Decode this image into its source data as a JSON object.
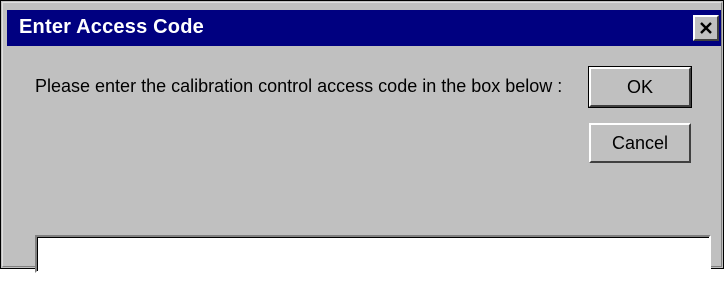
{
  "window": {
    "title": "Enter Access Code",
    "close_icon": "close-icon"
  },
  "content": {
    "prompt": "Please enter the calibration control access code in the box below :"
  },
  "buttons": {
    "ok_label": "OK",
    "cancel_label": "Cancel"
  },
  "access_code": {
    "value": "",
    "placeholder": ""
  },
  "colors": {
    "titlebar": "#000080",
    "dialog_bg": "#c0c0c0"
  }
}
